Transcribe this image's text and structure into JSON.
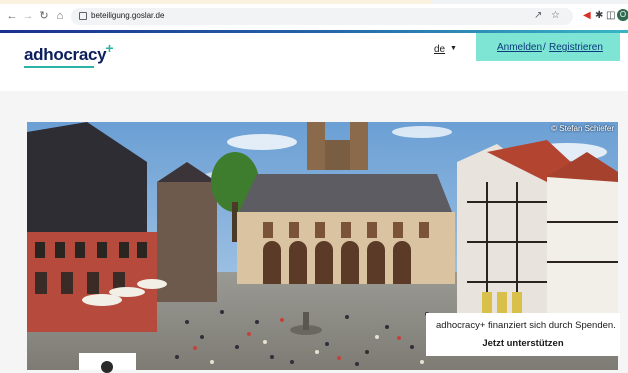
{
  "browser": {
    "url": "beteiligung.goslar.de",
    "profile_initial": "O",
    "nav_icons": [
      "back-icon",
      "forward-icon",
      "reload-icon",
      "home-icon"
    ],
    "toolbar_icons": [
      "share-icon",
      "bookmark-star-icon",
      "extension-icon",
      "puzzle-icon",
      "sidebar-icon"
    ]
  },
  "header": {
    "logo_text": "adhocracy",
    "logo_plus": "+",
    "language": "de",
    "login_label": "Anmelden",
    "separator": "/",
    "register_label": "Registrieren"
  },
  "hero": {
    "photo_credit": "© Stefan Schiefer",
    "donation_text": "adhocracy+ finanziert sich durch Spenden.",
    "donation_button": "Jetzt unterstützen"
  },
  "colors": {
    "accent": "#7ee4d4",
    "brand_navy": "#0b1f5c",
    "brand_teal": "#2bb3a3"
  }
}
